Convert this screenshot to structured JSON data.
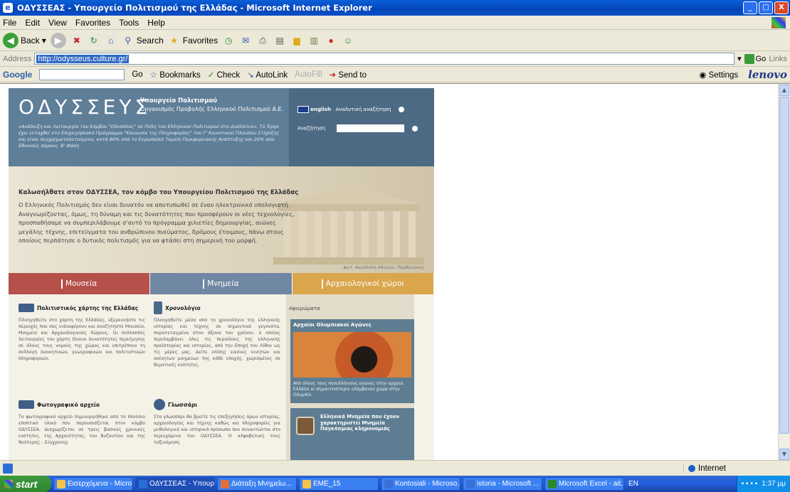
{
  "window": {
    "title": "ΟΔΥΣΣΕΑΣ - Υπουργείο Πολιτισμού της Ελλάδας - Microsoft Internet Explorer",
    "buttons": [
      "_",
      "□",
      "X"
    ]
  },
  "menu": [
    "File",
    "Edit",
    "View",
    "Favorites",
    "Tools",
    "Help"
  ],
  "toolbar": {
    "back": "Back",
    "search": "Search",
    "favorites": "Favorites"
  },
  "address": {
    "label": "Address",
    "url": "http://odysseus.culture.gr/",
    "go": "Go",
    "links": "Links"
  },
  "google": {
    "label": "Google",
    "go": "Go",
    "bookmarks": "Bookmarks",
    "check": "Check",
    "autolink": "AutoLink",
    "autofill": "AutoFill",
    "sendto": "Send to",
    "settings": "Settings",
    "brand": "lenovo"
  },
  "site": {
    "brand": "ΟΔΥΣΣΕΥΣ",
    "ministry_line1": "Υπουργείο Πολιτισμού",
    "ministry_line2": "Οργανισμός Προβολής Ελληνικού Πολιτισμού Α.Ε.",
    "blurb": "«Ανάδειξη και Λειτουργία του Κόμβου \"Οδυσσέας\" σε Πύλη του Ελληνικού Πολιτισμού στο Διαδίκτυο». Το Έργο έχει ενταχθεί στο Επιχειρησιακό Πρόγραμμα \"Κοινωνία της Πληροφορίας\" του Γ' Κοινοτικού Πλαισίου Στήριξης και είναι συγχρηματοδοτούμενο, κατά 80% από το Ευρωπαϊκό Ταμείο Περιφερειακής Ανάπτυξης και 20% από Εθνικούς πόρους. Β' Φάση",
    "english": "english",
    "advanced_search": "Αναλυτική αναζήτηση",
    "search_label": "Αναζήτηση",
    "welcome_title": "Καλωσήλθατε στον ΟΔΥΣΣΕΑ, τον κόμβο του Υπουργείου Πολιτισμού της Ελλάδας",
    "welcome_text": "Ο Ελληνικός Πολιτισμός δεν είναι δυνατόν να αποτυπωθεί σε έναν ηλεκτρονικό υπολογιστή. Αναγνωρίζοντας, όμως, τη δύναμη και τις δυνατότητες που προσφέρουν οι νέες τεχνολογίες, προσπαθήσαμε να συμπεριλάβουμε σ'αυτό το πρόγραμμα χιλιετίες δημιουργίας, αιώνες μεγάλης τέχνης, επιτεύγματα του ανθρώπινου πνεύματος, δρόμους έτοιμους, πάνω στους οποίους περπάτησε ο δυτικός πολιτισμός για να φτάσει στη σημερινή του μορφή.",
    "credit": "φωτ. Ακρόπολη Αθηνών, Παρθενώνας",
    "tabs": [
      {
        "label": "Μουσεία",
        "color": "#b6504a"
      },
      {
        "label": "Μνημεία",
        "color": "#6f87a3"
      },
      {
        "label": "Αρχαιολογικοί χώροι",
        "color": "#d9a64c"
      }
    ],
    "sections": [
      {
        "title": "Πολιτιστικός χάρτης της Ελλάδας",
        "text": "Πλοηγηθείτε στο χάρτη της Ελλάδας, εξερευνήστε τις περιοχές που σας ενδιαφέρουν και αναζητήστε Μουσεία, Μνημεία και Αρχαιολογικούς Χώρους. Οι πολλαπλές λειτουργίες του χάρτη δίνουν δυνατότητες περιήγησης σε όλους τους νομούς της χώρας και επιτρέπουν τη συλλογή διοικητικών, γεωγραφικών και πολιτιστικών πληροφοριών."
      },
      {
        "title": "Χρονολόγιο",
        "text": "Πλοηγηθείτε μέσα από το χρονολόγιο της ελληνικής ιστορίας και τέχνης σε σημαντικά γεγονότα, παρατεταγμένα στον άξονα του χρόνου, ο οποίος περιλαμβάνει όλες τις περιόδους της ελληνικής προϊστορίας και ιστορίας, από την Εποχή του Λίθου ως τις μέρες μας. Δείτε επίσης εικόνες κινητών και ακίνητων μνημείων της κάθε εποχής, χωρισμένες σε θεματικές ενότητες."
      },
      {
        "title": "Φωτογραφικό αρχείο",
        "text": "Το φωτογραφικό αρχείο δημιουργήθηκε από το πλούσιο εποπτικό υλικό που παρουσιάζεται στον κόμβο ΟΔΥΣΣΕΑ. Διαχωρίζεται σε τρεις βασικές χρονικές ενότητες, της Αρχαιότητας, του Βυζαντίου και της Νεότερης - Σύγχρονης"
      },
      {
        "title": "Γλωσσάρι",
        "text": "Στο γλωσσάρι θα βρείτε τις επεξηγήσεις όρων ιστορίας, αρχαιολογίας και τέχνης καθώς και πληροφορίες για μυθολογικά και ιστορικά πρόσωπα που συναντώνται στο περιεχόμενο του ΟΔΥΣΣΕΑ. Η αλφαβητική τους ταξινόμηση"
      }
    ],
    "side_title": "Αφιερώματα",
    "olympic_title": "Αρχαίοι Ολυμπιακοί Αγώνες",
    "olympic_text": "Από όλους τους πανελλήνιους αγώνες στην αρχαία Ελλάδα οι σημαντικότεροι ελάμβαναν χώρα στην Ολυμπία.",
    "unesco_text": "Ελληνικά Μνημεία που έχουν χαρακτηριστεί Μνημεία Παγκόσμιας κληρονομιάς"
  },
  "status": {
    "zone": "Internet"
  },
  "taskbar": {
    "start": "start",
    "tasks": [
      "Εισερχόμενα - Micro...",
      "ΟΔΥΣΣΕΑΣ - Υπουρ...",
      "Διάταξη Μνημείω...",
      "EME_15",
      "Kontosiali - Microso...",
      "istoria - Microsoft ...",
      "Microsoft Excel - ait..."
    ],
    "lang": "EN",
    "time": "1:37 μμ"
  }
}
